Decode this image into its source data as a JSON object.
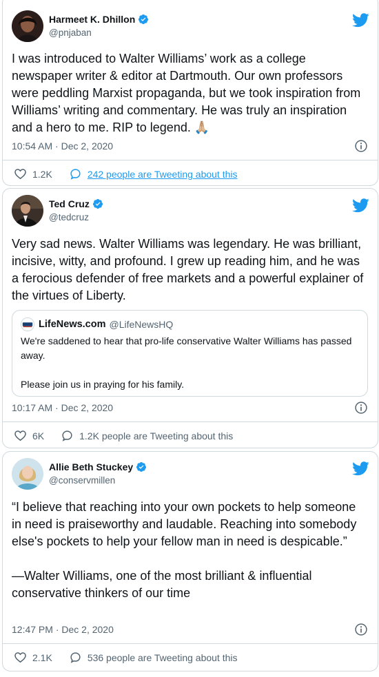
{
  "colors": {
    "twitter_blue": "#1d9bf0",
    "text_primary": "#0f1419",
    "text_secondary": "#536471",
    "border": "#cfd9de"
  },
  "tweets": [
    {
      "author": {
        "name": "Harmeet K. Dhillon",
        "handle": "@pnjaban",
        "verified": true
      },
      "text": "I was introduced to Walter Williams’ work as a college newspaper writer & editor at Dartmouth. Our own professors were peddling Marxist propaganda, but we took inspiration from Williams’ writing and commentary. He was truly an inspiration and a hero to me. RIP to legend. 🙏🏼",
      "timestamp": "10:54 AM · Dec 2, 2020",
      "likes": "1.2K",
      "conversation": "242 people are Tweeting about this"
    },
    {
      "author": {
        "name": "Ted Cruz",
        "handle": "@tedcruz",
        "verified": true
      },
      "text": "Very sad news. Walter Williams was legendary. He was brilliant, incisive, witty, and profound. I grew up reading him, and he was a ferocious defender of free markets and a powerful explainer of the virtues of Liberty.",
      "quote": {
        "name": "LifeNews.com",
        "handle": "@LifeNewsHQ",
        "text": "We're saddened to hear that pro-life conservative Walter Williams has passed away.\n\nPlease join us in praying for his family.",
        "logo_text": "LifeNews"
      },
      "timestamp": "10:17 AM · Dec 2, 2020",
      "likes": "6K",
      "conversation": "1.2K people are Tweeting about this"
    },
    {
      "author": {
        "name": "Allie Beth Stuckey",
        "handle": "@conservmillen",
        "verified": true
      },
      "text": "“I believe that reaching into your own pockets to help someone in need is praiseworthy and laudable. Reaching into somebody else's pockets to help your fellow man in need is despicable.”\n\n—Walter Williams, one of the most brilliant & influential conservative thinkers of our time",
      "timestamp": "12:47 PM · Dec 2, 2020",
      "likes": "2.1K",
      "conversation": "536 people are Tweeting about this"
    }
  ],
  "icons": {
    "bird": "twitter-bird-icon",
    "verified": "verified-badge-icon",
    "info": "info-icon",
    "like": "heart-icon",
    "reply": "speech-bubble-icon"
  }
}
